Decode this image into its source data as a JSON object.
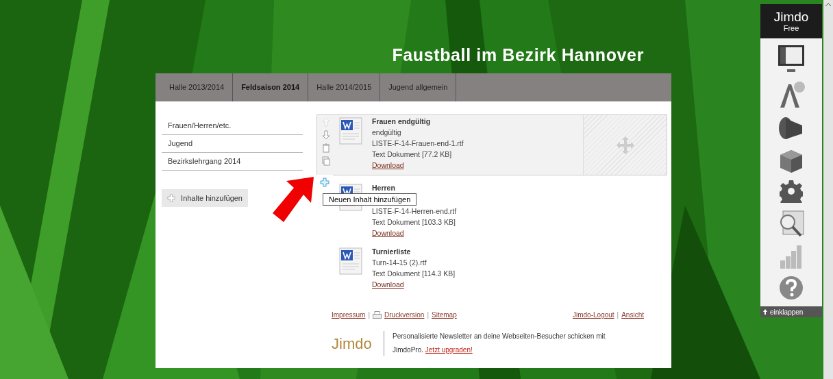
{
  "site_title": "Faustball im Bezirk Hannover",
  "nav_tabs": [
    {
      "label": "Halle 2013/2014",
      "selected": false
    },
    {
      "label": "Feldsaison 2014",
      "selected": true
    },
    {
      "label": "Halle 2014/2015",
      "selected": false
    },
    {
      "label": "Jugend allgemein",
      "selected": false
    }
  ],
  "subnav": [
    {
      "label": "Frauen/Herren/etc."
    },
    {
      "label": "Jugend"
    },
    {
      "label": "Bezirkslehrgang 2014"
    }
  ],
  "add_content_button": "Inhalte hinzufügen",
  "documents": [
    {
      "title": "Frauen endgültig",
      "lines": [
        "endgültig",
        "LISTE-F-14-Frauen-end-1.rtf",
        "Text Dokument [77.2 KB]"
      ],
      "link": "Download",
      "selected": true
    },
    {
      "title": "Herren",
      "lines": [
        "LISTE-F-14-Herren-end.rtf",
        "Text Dokument [103.3 KB]"
      ],
      "link": "Download",
      "selected": false
    },
    {
      "title": "Turnierliste",
      "lines": [
        "Turn-14-15 (2).rtf",
        "Text Dokument [114.3 KB]"
      ],
      "link": "Download",
      "selected": false
    }
  ],
  "tooltip": "Neuen Inhalt hinzufügen",
  "footer": {
    "left_links": [
      "Impressum",
      "Druckversion",
      "Sitemap"
    ],
    "separator": "|",
    "right_links": [
      "Jimdo-Logout",
      "Ansicht"
    ]
  },
  "promo": {
    "logo": "Jimdo",
    "text": "Personalisierte Newsletter an deine Webseiten-Besucher schicken mit JimdoPro.",
    "link": "Jetzt upgraden!"
  },
  "admin_panel": {
    "brand": "Jimdo",
    "plan": "Free",
    "collapse": "einklappen"
  }
}
